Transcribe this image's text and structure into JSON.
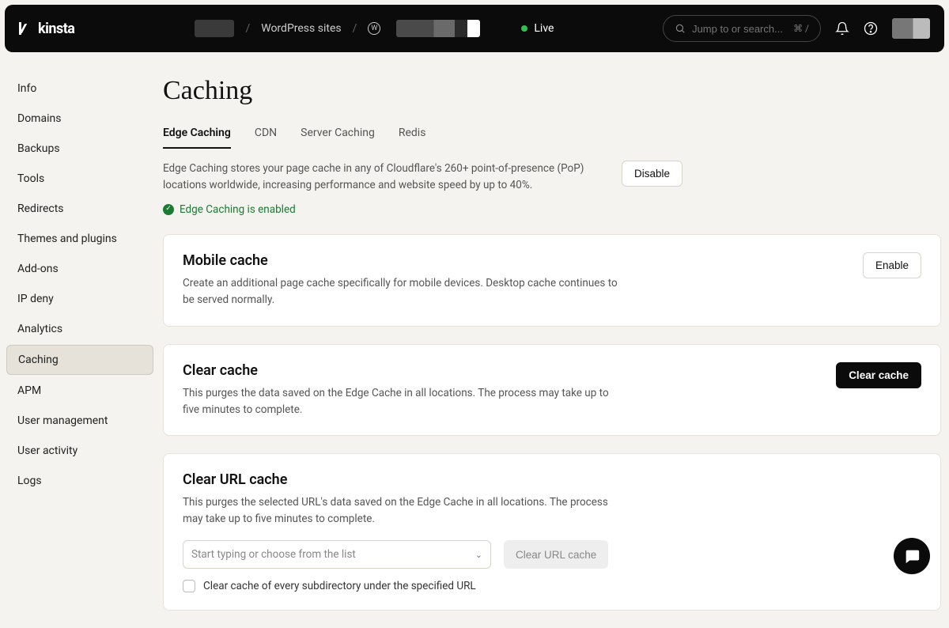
{
  "brand": "kinsta",
  "breadcrumbs": {
    "wp_sites": "WordPress sites"
  },
  "environment": {
    "label": "Live"
  },
  "search": {
    "placeholder": "Jump to or search...",
    "shortcut": "⌘ /"
  },
  "sidebar": {
    "items": [
      {
        "label": "Info"
      },
      {
        "label": "Domains"
      },
      {
        "label": "Backups"
      },
      {
        "label": "Tools"
      },
      {
        "label": "Redirects"
      },
      {
        "label": "Themes and plugins"
      },
      {
        "label": "Add-ons"
      },
      {
        "label": "IP deny"
      },
      {
        "label": "Analytics"
      },
      {
        "label": "Caching"
      },
      {
        "label": "APM"
      },
      {
        "label": "User management"
      },
      {
        "label": "User activity"
      },
      {
        "label": "Logs"
      }
    ],
    "activeIndex": 9
  },
  "page_title": "Caching",
  "tabs": [
    {
      "label": "Edge Caching"
    },
    {
      "label": "CDN"
    },
    {
      "label": "Server Caching"
    },
    {
      "label": "Redis"
    }
  ],
  "intro": {
    "text": "Edge Caching stores your page cache in any of Cloudflare's 260+ point-of-presence (PoP) locations worldwide, increasing performance and website speed by up to 40%.",
    "status": "Edge Caching is enabled",
    "disable_btn": "Disable"
  },
  "mobile": {
    "title": "Mobile cache",
    "desc": "Create an additional page cache specifically for mobile devices. Desktop cache continues to be served normally.",
    "btn": "Enable"
  },
  "clear": {
    "title": "Clear cache",
    "desc": "This purges the data saved on the Edge Cache in all locations. The process may take up to five minutes to complete.",
    "btn": "Clear cache"
  },
  "url": {
    "title": "Clear URL cache",
    "desc": "This purges the selected URL's data saved on the Edge Cache in all locations. The process may take up to five minutes to complete.",
    "placeholder": "Start typing or choose from the list",
    "btn": "Clear URL cache",
    "checkbox": "Clear cache of every subdirectory under the specified URL"
  }
}
